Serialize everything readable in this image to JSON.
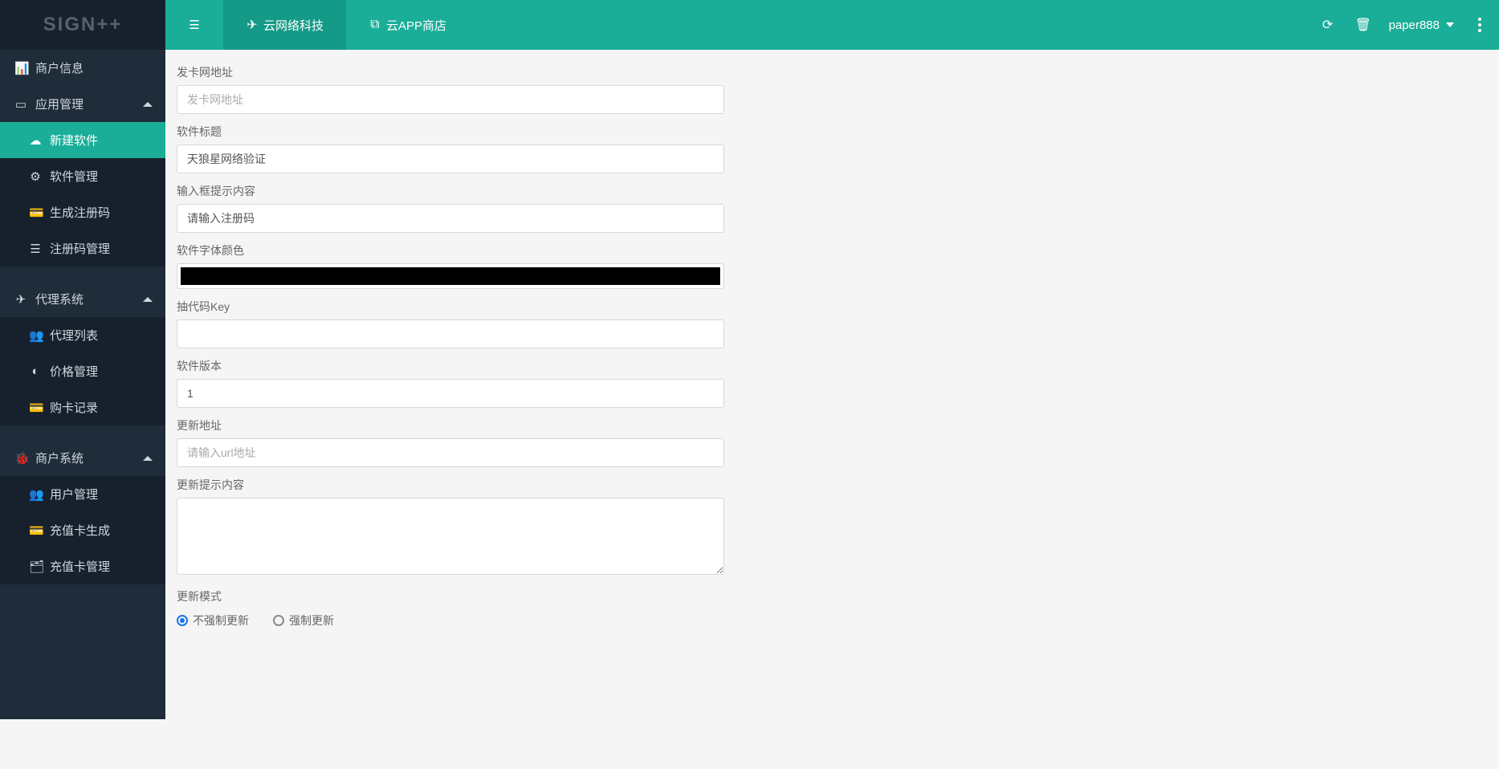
{
  "brand": "SIGN++",
  "top": {
    "toggle": "≡",
    "tab1": "云网络科技",
    "tab2": "云APP商店",
    "user": "paper888"
  },
  "side": {
    "merchantInfo": "商户信息",
    "appMgmt": "应用管理",
    "newSoft": "新建软件",
    "softMgmt": "软件管理",
    "genCode": "生成注册码",
    "codeMgmt": "注册码管理",
    "agentSys": "代理系统",
    "agentList": "代理列表",
    "priceMgmt": "价格管理",
    "buyRecord": "购卡记录",
    "merchantSys": "商户系统",
    "userMgmt": "用户管理",
    "cardGen": "充值卡生成",
    "cardMgmt": "充值卡管理"
  },
  "form": {
    "f1_label": "发卡网地址",
    "f1_ph": "发卡网地址",
    "f1_val": "",
    "f2_label": "软件标题",
    "f2_val": "天狼星网络验证",
    "f3_label": "输入框提示内容",
    "f3_val": "请输入注册码",
    "f4_label": "软件字体颜色",
    "f4_val": "#000000",
    "f5_label": "抽代码Key",
    "f5_val": "",
    "f6_label": "软件版本",
    "f6_val": "1",
    "f7_label": "更新地址",
    "f7_ph": "请输入url地址",
    "f7_val": "",
    "f8_label": "更新提示内容",
    "f8_val": "",
    "f9_label": "更新模式",
    "f9_opt1": "不强制更新",
    "f9_opt2": "强制更新"
  }
}
